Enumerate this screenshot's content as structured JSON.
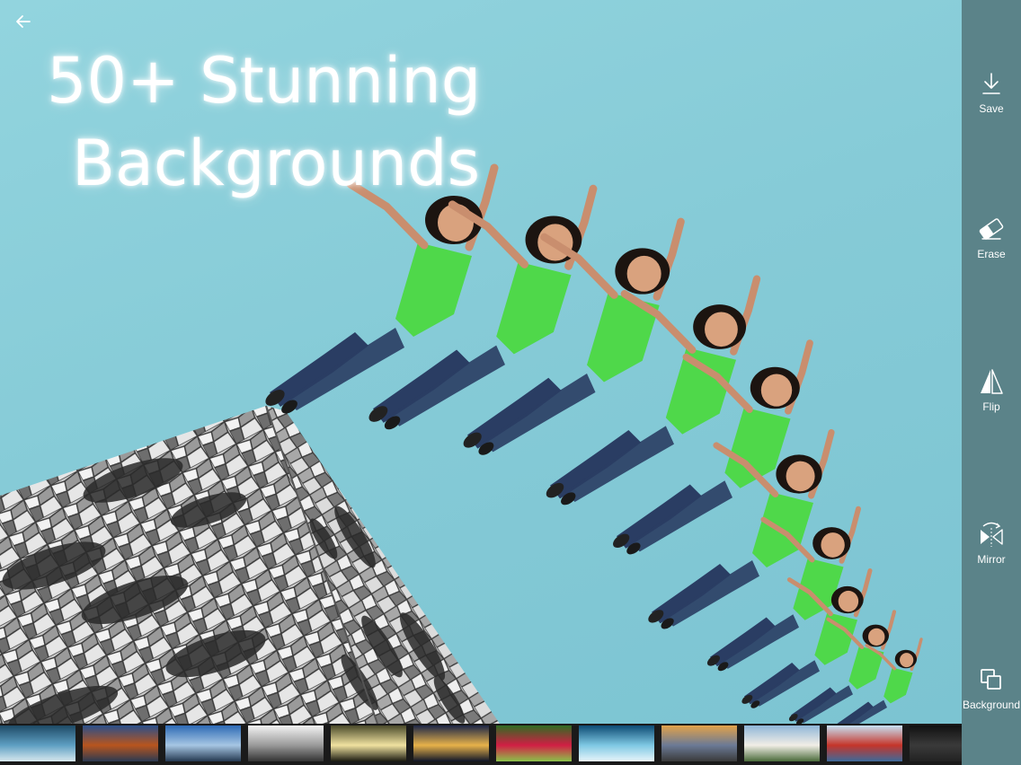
{
  "header": {
    "back_icon": "arrow-left-icon",
    "promo_line1": "50+  Stunning",
    "promo_line2": "Backgrounds"
  },
  "toolbar": {
    "items": [
      {
        "id": "save",
        "label": "Save",
        "icon": "download-icon"
      },
      {
        "id": "erase",
        "label": "Erase",
        "icon": "eraser-icon"
      },
      {
        "id": "flip",
        "label": "Flip",
        "icon": "flip-icon"
      },
      {
        "id": "mirror",
        "label": "Mirror",
        "icon": "mirror-icon"
      },
      {
        "id": "background",
        "label": "Background",
        "icon": "layers-icon"
      }
    ],
    "color": "#5b8389"
  },
  "background_strip": {
    "thumbnails": [
      {
        "name": "lake-boats",
        "colors": [
          "#1e4a66",
          "#5e9fc2",
          "#d8e8ef"
        ]
      },
      {
        "name": "autumn-lake",
        "colors": [
          "#2a4f8a",
          "#b8551e",
          "#2b3a52"
        ]
      },
      {
        "name": "pier-sunset",
        "colors": [
          "#2d6ab5",
          "#a6c6e3",
          "#243850"
        ]
      },
      {
        "name": "motorbike-stunt",
        "colors": [
          "#f3f3f3",
          "#9a9a9a",
          "#333333"
        ]
      },
      {
        "name": "tunnel-light",
        "colors": [
          "#4a4a2a",
          "#f0e2a0",
          "#1a1a10"
        ]
      },
      {
        "name": "city-night",
        "colors": [
          "#1d2747",
          "#e7b24a",
          "#0f1528"
        ]
      },
      {
        "name": "red-tulip",
        "colors": [
          "#2f6c22",
          "#d11e44",
          "#8bc34a"
        ]
      },
      {
        "name": "ocean-wave",
        "colors": [
          "#0d4a73",
          "#7ec8e3",
          "#e9f6fb"
        ]
      },
      {
        "name": "desert-road",
        "colors": [
          "#e2a24a",
          "#6b7a96",
          "#3a3a3a"
        ]
      },
      {
        "name": "taj-mahal",
        "colors": [
          "#8fb6d8",
          "#f1eee6",
          "#4a6b3a"
        ]
      },
      {
        "name": "golden-gate",
        "colors": [
          "#c7e2f4",
          "#c5352a",
          "#3d6a9a"
        ]
      },
      {
        "name": "dark-texture",
        "colors": [
          "#111111",
          "#3a3a3a",
          "#222222"
        ]
      }
    ]
  },
  "canvas": {
    "sky_color": "#86cbd7",
    "shirt_color": "#4fd84a",
    "jeans_color": "#2a3d63",
    "jumper_count": 10
  }
}
